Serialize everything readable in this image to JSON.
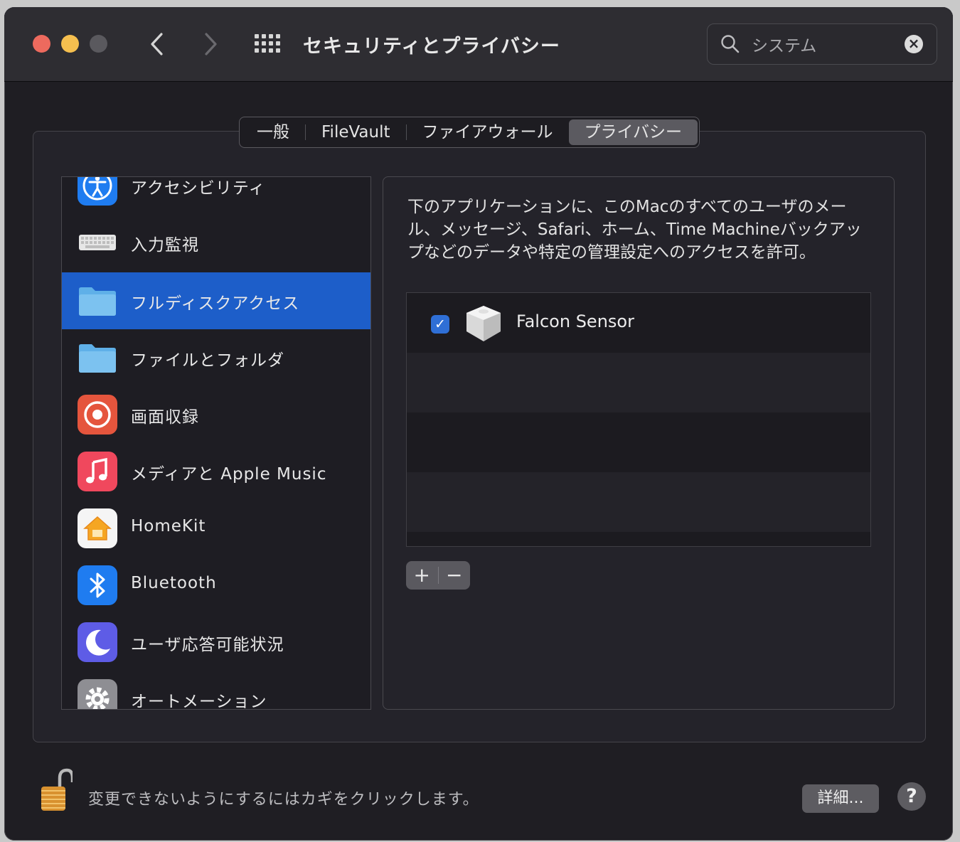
{
  "window": {
    "title": "セキュリティとプライバシー",
    "traffic_colors": {
      "close": "#ed6a5e",
      "minimize": "#f5bf4f",
      "zoom": "#5a595e"
    }
  },
  "search": {
    "value": "システム"
  },
  "tabs": [
    {
      "label": "一般",
      "selected": false
    },
    {
      "label": "FileVault",
      "selected": false
    },
    {
      "label": "ファイアウォール",
      "selected": false
    },
    {
      "label": "プライバシー",
      "selected": true
    }
  ],
  "sidebar": {
    "items": [
      {
        "label": "アクセシビリティ",
        "icon": "accessibility-icon",
        "selected": false
      },
      {
        "label": "入力監視",
        "icon": "keyboard-icon",
        "selected": false
      },
      {
        "label": "フルディスクアクセス",
        "icon": "folder-icon",
        "selected": true
      },
      {
        "label": "ファイルとフォルダ",
        "icon": "folder-icon",
        "selected": false
      },
      {
        "label": "画面収録",
        "icon": "screen-record-icon",
        "selected": false
      },
      {
        "label": "メディアと Apple Music",
        "icon": "music-icon",
        "selected": false
      },
      {
        "label": "HomeKit",
        "icon": "home-icon",
        "selected": false
      },
      {
        "label": "Bluetooth",
        "icon": "bluetooth-icon",
        "selected": false
      },
      {
        "label": "ユーザ応答可能状況",
        "icon": "moon-icon",
        "selected": false
      },
      {
        "label": "オートメーション",
        "icon": "gear-icon",
        "selected": false
      }
    ]
  },
  "panel": {
    "description": "下のアプリケーションに、このMacのすべてのユーザのメール、メッセージ、Safari、ホーム、Time Machineバックアップなどのデータや特定の管理設定へのアクセスを許可。",
    "apps": [
      {
        "name": "Falcon Sensor",
        "checked": true,
        "icon": "falcon-sensor-icon"
      }
    ],
    "add_label": "+",
    "remove_label": "−"
  },
  "footer": {
    "lock_text": "変更できないようにするにはカギをクリックします。",
    "details_label": "詳細...",
    "help_label": "?"
  }
}
